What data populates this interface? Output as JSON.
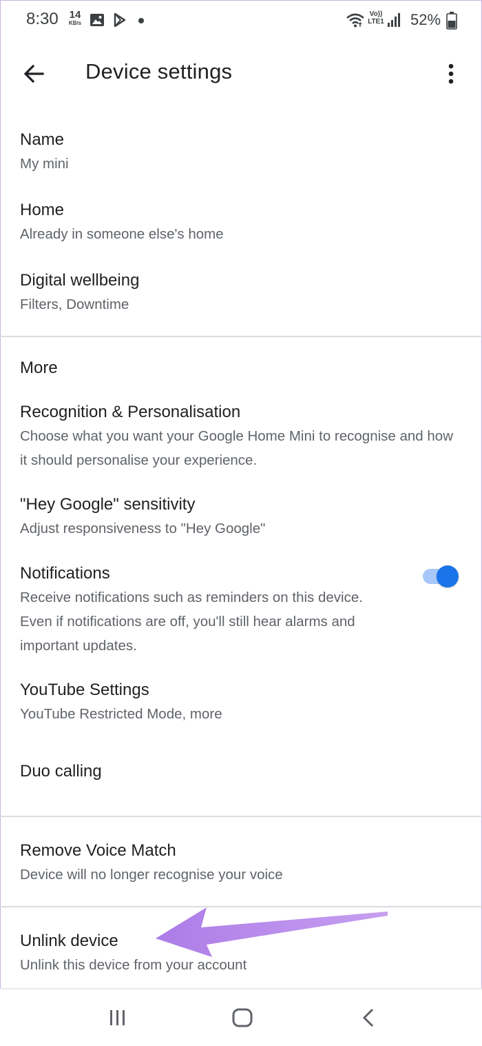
{
  "status_bar": {
    "time": "8:30",
    "speed_value": "14",
    "speed_unit": "KB/s",
    "network_label_top": "Vo))",
    "network_label_bottom": "LTE1",
    "battery_percent": "52%"
  },
  "app_bar": {
    "title": "Device settings"
  },
  "general": {
    "items": [
      {
        "title": "Name",
        "subtitle": "My mini"
      },
      {
        "title": "Home",
        "subtitle": "Already in someone else's home"
      },
      {
        "title": "Digital wellbeing",
        "subtitle": "Filters, Downtime"
      }
    ]
  },
  "more": {
    "header": "More",
    "items": [
      {
        "title": "Recognition & Personalisation",
        "subtitle": "Choose what you want your Google Home Mini to recognise and how it should personalise your experience."
      },
      {
        "title": "\"Hey Google\" sensitivity",
        "subtitle": "Adjust responsiveness to \"Hey Google\""
      },
      {
        "title": "Notifications",
        "subtitle": "Receive notifications such as reminders on this device. Even if notifications are off, you'll still hear alarms and important updates.",
        "toggle_on": true
      },
      {
        "title": "YouTube Settings",
        "subtitle": "YouTube Restricted Mode, more"
      },
      {
        "title": "Duo calling",
        "subtitle": ""
      }
    ]
  },
  "voice_match": {
    "title": "Remove Voice Match",
    "subtitle": "Device will no longer recognise your voice"
  },
  "unlink": {
    "title": "Unlink device",
    "subtitle": "Unlink this device from your account"
  },
  "colors": {
    "accent": "#1a73e8",
    "toggle_track": "#a8c7fa",
    "annotation_arrow": "#b07ee6",
    "divider": "#dadce0"
  },
  "icons": {
    "back": "arrow-left-icon",
    "overflow": "more-vert-icon",
    "nav_recents": "recents-icon",
    "nav_home": "home-icon",
    "nav_back": "nav-back-icon"
  }
}
